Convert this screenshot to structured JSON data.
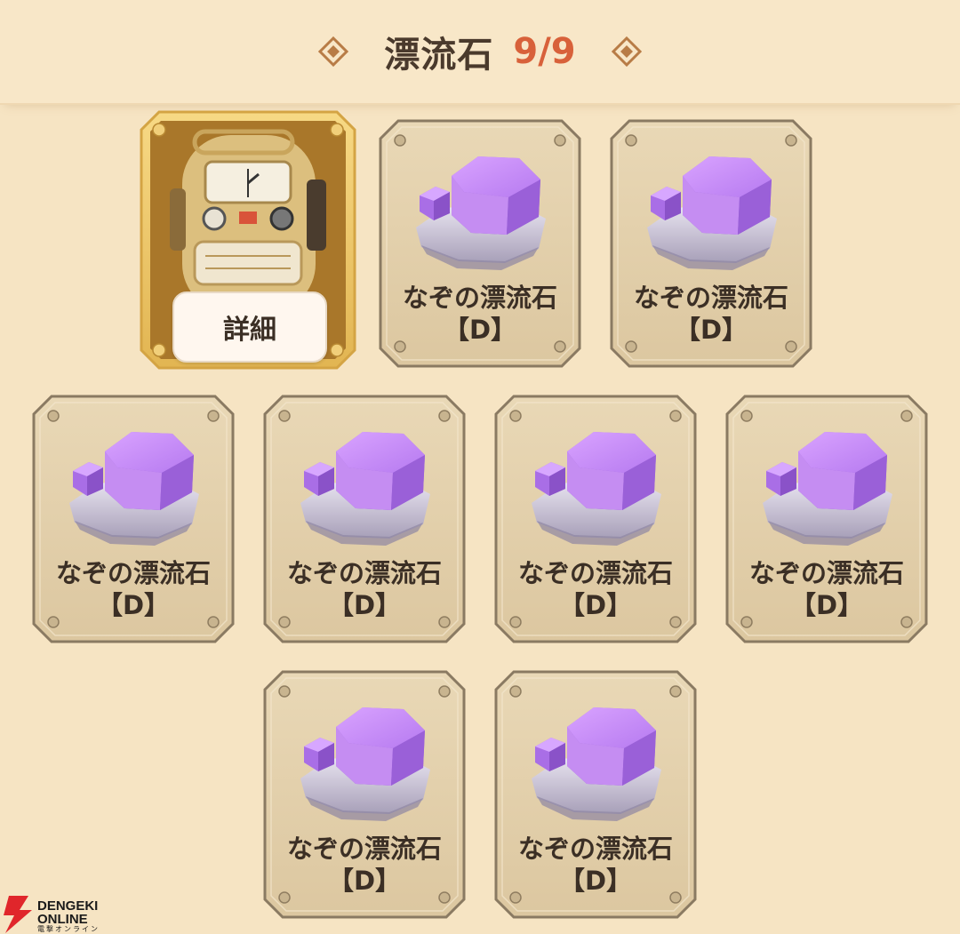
{
  "header": {
    "title": "漂流石",
    "count": "9/9",
    "count_color": "#d8613a"
  },
  "featured": {
    "icon": "diving-helmet-robot-icon",
    "detail_label": "詳細"
  },
  "items": [
    {
      "name": "なぞの漂流石",
      "rank": "【D】",
      "icon": "purple-crystal-icon"
    },
    {
      "name": "なぞの漂流石",
      "rank": "【D】",
      "icon": "purple-crystal-icon"
    },
    {
      "name": "なぞの漂流石",
      "rank": "【D】",
      "icon": "purple-crystal-icon"
    },
    {
      "name": "なぞの漂流石",
      "rank": "【D】",
      "icon": "purple-crystal-icon"
    },
    {
      "name": "なぞの漂流石",
      "rank": "【D】",
      "icon": "purple-crystal-icon"
    },
    {
      "name": "なぞの漂流石",
      "rank": "【D】",
      "icon": "purple-crystal-icon"
    },
    {
      "name": "なぞの漂流石",
      "rank": "【D】",
      "icon": "purple-crystal-icon"
    },
    {
      "name": "なぞの漂流石",
      "rank": "【D】",
      "icon": "purple-crystal-icon"
    }
  ],
  "watermark": {
    "line1": "DENGEKI",
    "line2": "ONLINE",
    "line3": "電撃オンライン"
  }
}
